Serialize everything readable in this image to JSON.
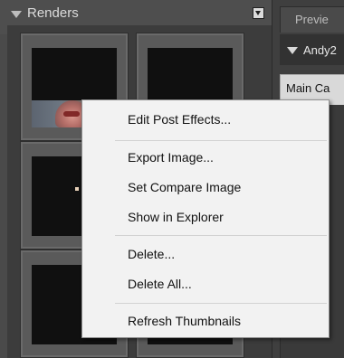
{
  "renders_panel": {
    "title": "Renders"
  },
  "right_panel": {
    "preview_tab_label": "Previe",
    "scene_item_label": "Andy2",
    "camera_select_value": "Main Ca"
  },
  "context_menu": {
    "items": [
      {
        "label": "Edit Post Effects..."
      },
      {
        "label": "Export Image..."
      },
      {
        "label": "Set Compare Image"
      },
      {
        "label": "Show in Explorer"
      },
      {
        "label": "Delete..."
      },
      {
        "label": "Delete All..."
      },
      {
        "label": "Refresh Thumbnails"
      }
    ]
  },
  "icons": {
    "panel_collapse": "triangle-down-icon",
    "panel_menu": "panel-menu-icon"
  }
}
